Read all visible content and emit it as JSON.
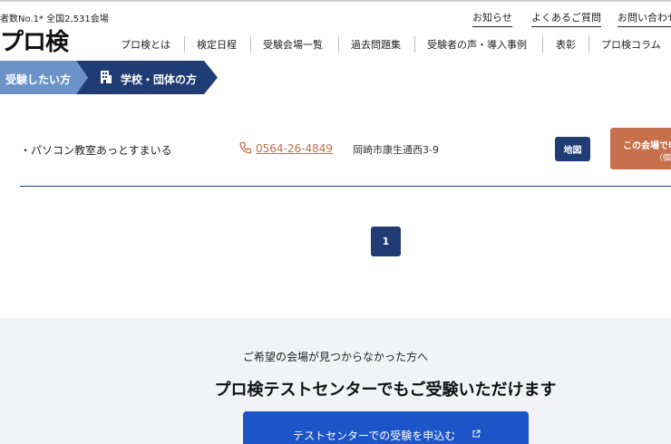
{
  "header": {
    "tagline": "者数No.1* 全国2,531会場",
    "logo": "プロ検"
  },
  "util_nav": [
    "お知らせ",
    "よくあるご質問",
    "お問い合わせ"
  ],
  "main_nav": [
    "プロ検とは",
    "検定日程",
    "受験会場一覧",
    "過去問題集",
    "受験者の声・導入事例",
    "表彰",
    "プロ検コラム"
  ],
  "tabs": {
    "individual": "受験したい方",
    "school": "学校・団体の方",
    "school_icon": "building-icon"
  },
  "venue": {
    "name": "・パソコン教室あっとすまいる",
    "phone": "0564-26-4849",
    "address": "岡崎市康生通西3-9",
    "map_label": "地図",
    "apply_line1": "この会場で申し込む",
    "apply_line2": "（個人）"
  },
  "pagination": {
    "current": "1"
  },
  "cta": {
    "subtitle": "ご希望の会場が見つからなかった方へ",
    "title": "プロ検テストセンターでもご受験いただけます",
    "button_label": "テストセンターでの受験を申込む"
  },
  "colors": {
    "navy": "#1f3d74",
    "light_blue": "#6c93c8",
    "orange": "#c6714b",
    "blue_button": "#1c55c8"
  }
}
